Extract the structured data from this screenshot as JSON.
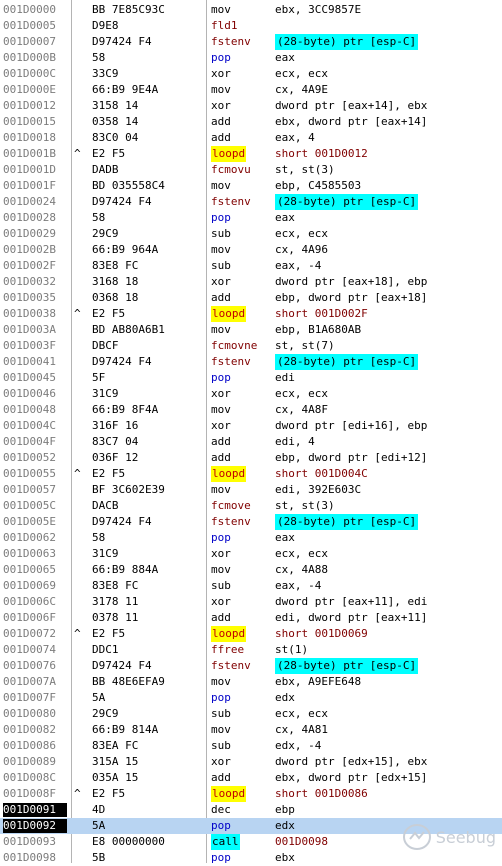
{
  "rows": [
    {
      "addr": "001D0000",
      "j": "",
      "bytes": "BB 7E85C93C",
      "m": "mov",
      "o": "ebx, 3CC9857E",
      "t": "n"
    },
    {
      "addr": "001D0005",
      "j": "",
      "bytes": "D9E8",
      "m": "fld1",
      "o": "",
      "t": "fpu"
    },
    {
      "addr": "001D0007",
      "j": "",
      "bytes": "D97424 F4",
      "m": "fstenv",
      "o": "(28-byte) ptr [esp-C]",
      "t": "fstenv"
    },
    {
      "addr": "001D000B",
      "j": "",
      "bytes": "58",
      "m": "pop",
      "o": "eax",
      "t": "blue"
    },
    {
      "addr": "001D000C",
      "j": "",
      "bytes": "33C9",
      "m": "xor",
      "o": "ecx, ecx",
      "t": "n"
    },
    {
      "addr": "001D000E",
      "j": "",
      "bytes": "66:B9 9E4A",
      "m": "mov",
      "o": "cx, 4A9E",
      "t": "n"
    },
    {
      "addr": "001D0012",
      "j": "",
      "bytes": "3158 14",
      "m": "xor",
      "o": "dword ptr [eax+14], ebx",
      "t": "n"
    },
    {
      "addr": "001D0015",
      "j": "",
      "bytes": "0358 14",
      "m": "add",
      "o": "ebx, dword ptr [eax+14]",
      "t": "n"
    },
    {
      "addr": "001D0018",
      "j": "",
      "bytes": "83C0 04",
      "m": "add",
      "o": "eax, 4",
      "t": "n"
    },
    {
      "addr": "001D001B",
      "j": "^",
      "bytes": "E2 F5",
      "m": "loopd",
      "o": "short 001D0012",
      "t": "loop"
    },
    {
      "addr": "001D001D",
      "j": "",
      "bytes": "DADB",
      "m": "fcmovu",
      "o": "st, st(3)",
      "t": "fpu"
    },
    {
      "addr": "001D001F",
      "j": "",
      "bytes": "BD 035558C4",
      "m": "mov",
      "o": "ebp, C4585503",
      "t": "n"
    },
    {
      "addr": "001D0024",
      "j": "",
      "bytes": "D97424 F4",
      "m": "fstenv",
      "o": "(28-byte) ptr [esp-C]",
      "t": "fstenv"
    },
    {
      "addr": "001D0028",
      "j": "",
      "bytes": "58",
      "m": "pop",
      "o": "eax",
      "t": "blue"
    },
    {
      "addr": "001D0029",
      "j": "",
      "bytes": "29C9",
      "m": "sub",
      "o": "ecx, ecx",
      "t": "n"
    },
    {
      "addr": "001D002B",
      "j": "",
      "bytes": "66:B9 964A",
      "m": "mov",
      "o": "cx, 4A96",
      "t": "n"
    },
    {
      "addr": "001D002F",
      "j": "",
      "bytes": "83E8 FC",
      "m": "sub",
      "o": "eax, -4",
      "t": "n"
    },
    {
      "addr": "001D0032",
      "j": "",
      "bytes": "3168 18",
      "m": "xor",
      "o": "dword ptr [eax+18], ebp",
      "t": "n"
    },
    {
      "addr": "001D0035",
      "j": "",
      "bytes": "0368 18",
      "m": "add",
      "o": "ebp, dword ptr [eax+18]",
      "t": "n"
    },
    {
      "addr": "001D0038",
      "j": "^",
      "bytes": "E2 F5",
      "m": "loopd",
      "o": "short 001D002F",
      "t": "loop"
    },
    {
      "addr": "001D003A",
      "j": "",
      "bytes": "BD AB80A6B1",
      "m": "mov",
      "o": "ebp, B1A680AB",
      "t": "n"
    },
    {
      "addr": "001D003F",
      "j": "",
      "bytes": "DBCF",
      "m": "fcmovne",
      "o": "st, st(7)",
      "t": "fpu"
    },
    {
      "addr": "001D0041",
      "j": "",
      "bytes": "D97424 F4",
      "m": "fstenv",
      "o": "(28-byte) ptr [esp-C]",
      "t": "fstenv"
    },
    {
      "addr": "001D0045",
      "j": "",
      "bytes": "5F",
      "m": "pop",
      "o": "edi",
      "t": "blue"
    },
    {
      "addr": "001D0046",
      "j": "",
      "bytes": "31C9",
      "m": "xor",
      "o": "ecx, ecx",
      "t": "n"
    },
    {
      "addr": "001D0048",
      "j": "",
      "bytes": "66:B9 8F4A",
      "m": "mov",
      "o": "cx, 4A8F",
      "t": "n"
    },
    {
      "addr": "001D004C",
      "j": "",
      "bytes": "316F 16",
      "m": "xor",
      "o": "dword ptr [edi+16], ebp",
      "t": "n"
    },
    {
      "addr": "001D004F",
      "j": "",
      "bytes": "83C7 04",
      "m": "add",
      "o": "edi, 4",
      "t": "n"
    },
    {
      "addr": "001D0052",
      "j": "",
      "bytes": "036F 12",
      "m": "add",
      "o": "ebp, dword ptr [edi+12]",
      "t": "n"
    },
    {
      "addr": "001D0055",
      "j": "^",
      "bytes": "E2 F5",
      "m": "loopd",
      "o": "short 001D004C",
      "t": "loop"
    },
    {
      "addr": "001D0057",
      "j": "",
      "bytes": "BF 3C602E39",
      "m": "mov",
      "o": "edi, 392E603C",
      "t": "n"
    },
    {
      "addr": "001D005C",
      "j": "",
      "bytes": "DACB",
      "m": "fcmove",
      "o": "st, st(3)",
      "t": "fpu"
    },
    {
      "addr": "001D005E",
      "j": "",
      "bytes": "D97424 F4",
      "m": "fstenv",
      "o": "(28-byte) ptr [esp-C]",
      "t": "fstenv"
    },
    {
      "addr": "001D0062",
      "j": "",
      "bytes": "58",
      "m": "pop",
      "o": "eax",
      "t": "blue"
    },
    {
      "addr": "001D0063",
      "j": "",
      "bytes": "31C9",
      "m": "xor",
      "o": "ecx, ecx",
      "t": "n"
    },
    {
      "addr": "001D0065",
      "j": "",
      "bytes": "66:B9 884A",
      "m": "mov",
      "o": "cx, 4A88",
      "t": "n"
    },
    {
      "addr": "001D0069",
      "j": "",
      "bytes": "83E8 FC",
      "m": "sub",
      "o": "eax, -4",
      "t": "n"
    },
    {
      "addr": "001D006C",
      "j": "",
      "bytes": "3178 11",
      "m": "xor",
      "o": "dword ptr [eax+11], edi",
      "t": "n"
    },
    {
      "addr": "001D006F",
      "j": "",
      "bytes": "0378 11",
      "m": "add",
      "o": "edi, dword ptr [eax+11]",
      "t": "n"
    },
    {
      "addr": "001D0072",
      "j": "^",
      "bytes": "E2 F5",
      "m": "loopd",
      "o": "short 001D0069",
      "t": "loop"
    },
    {
      "addr": "001D0074",
      "j": "",
      "bytes": "DDC1",
      "m": "ffree",
      "o": "st(1)",
      "t": "fpu"
    },
    {
      "addr": "001D0076",
      "j": "",
      "bytes": "D97424 F4",
      "m": "fstenv",
      "o": "(28-byte) ptr [esp-C]",
      "t": "fstenv"
    },
    {
      "addr": "001D007A",
      "j": "",
      "bytes": "BB 48E6EFA9",
      "m": "mov",
      "o": "ebx, A9EFE648",
      "t": "n"
    },
    {
      "addr": "001D007F",
      "j": "",
      "bytes": "5A",
      "m": "pop",
      "o": "edx",
      "t": "blue"
    },
    {
      "addr": "001D0080",
      "j": "",
      "bytes": "29C9",
      "m": "sub",
      "o": "ecx, ecx",
      "t": "n"
    },
    {
      "addr": "001D0082",
      "j": "",
      "bytes": "66:B9 814A",
      "m": "mov",
      "o": "cx, 4A81",
      "t": "n"
    },
    {
      "addr": "001D0086",
      "j": "",
      "bytes": "83EA FC",
      "m": "sub",
      "o": "edx, -4",
      "t": "n"
    },
    {
      "addr": "001D0089",
      "j": "",
      "bytes": "315A 15",
      "m": "xor",
      "o": "dword ptr [edx+15], ebx",
      "t": "n"
    },
    {
      "addr": "001D008C",
      "j": "",
      "bytes": "035A 15",
      "m": "add",
      "o": "ebx, dword ptr [edx+15]",
      "t": "n"
    },
    {
      "addr": "001D008F",
      "j": "^",
      "bytes": "E2 F5",
      "m": "loopd",
      "o": "short 001D0086",
      "t": "loop"
    },
    {
      "addr": "001D0091",
      "j": "",
      "bytes": "4D",
      "m": "dec",
      "o": "ebp",
      "t": "n",
      "hiAddr": true
    },
    {
      "addr": "001D0092",
      "j": "",
      "bytes": "5A",
      "m": "pop",
      "o": "edx",
      "t": "blue",
      "hiAddr": true,
      "sel": true
    },
    {
      "addr": "001D0093",
      "j": "",
      "bytes": "E8 00000000",
      "m": "call",
      "o": "001D0098",
      "t": "call"
    },
    {
      "addr": "001D0098",
      "j": "",
      "bytes": "5B",
      "m": "pop",
      "o": "ebx",
      "t": "blue"
    }
  ],
  "watermark": {
    "text": "Seebug",
    "icon": "seebug-logo-icon"
  }
}
